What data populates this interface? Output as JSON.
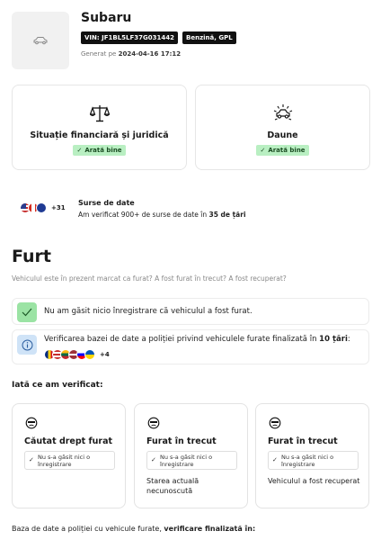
{
  "vehicle": {
    "make": "Subaru",
    "vin": "VIN: JF1BL5LF37G031442",
    "fuel": "Benzină, GPL",
    "generated_label": "Generat pe",
    "generated_date": "2024-04-16 17:12",
    "thumbnail_icon": "car-icon"
  },
  "status_cards": [
    {
      "title": "Situație financiară și juridică",
      "badge": "Arată bine",
      "icon": "scales-icon"
    },
    {
      "title": "Daune",
      "badge": "Arată bine",
      "icon": "damage-icon"
    }
  ],
  "sources": {
    "extra_count": "+31",
    "title": "Surse de date",
    "desc_prefix": "Am verificat 900+ de surse de date în ",
    "desc_bold": "35 de țări"
  },
  "theft": {
    "title": "Furt",
    "subtitle": "Vehiculul este în prezent marcat ca furat? A fost furat în trecut? A fost recuperat?",
    "no_record": "Nu am găsit nicio înregistrare că vehiculul a fost furat.",
    "police_prefix": "Verificarea bazei de date a poliției privind vehiculele furate finalizată în ",
    "police_bold": "10 țări",
    "police_suffix": ":",
    "police_extra_count": "+4"
  },
  "checked": {
    "title": "Iată ce am verificat:",
    "cards": [
      {
        "title": "Căutat drept furat",
        "result": "Nu s-a găsit nici o înregistrare",
        "extra_line1": "",
        "extra_line2": ""
      },
      {
        "title": "Furat în trecut",
        "result": "Nu s-a găsit nici o înregistrare",
        "extra_line1": "Starea actuală",
        "extra_line2": "necunoscută"
      },
      {
        "title": "Furat în trecut",
        "result": "Nu s-a găsit nici o înregistrare",
        "extra_line1": "Vehiculul a fost recuperat",
        "extra_line2": ""
      }
    ]
  },
  "footer": {
    "text": "Baza de date a poliției cu vehicule furate, ",
    "bold": "verificare finalizată în:"
  },
  "colors": {
    "good_badge_bg": "#b9efc2",
    "check_bg": "#9be3a4",
    "info_bg": "#cfe3f7"
  }
}
